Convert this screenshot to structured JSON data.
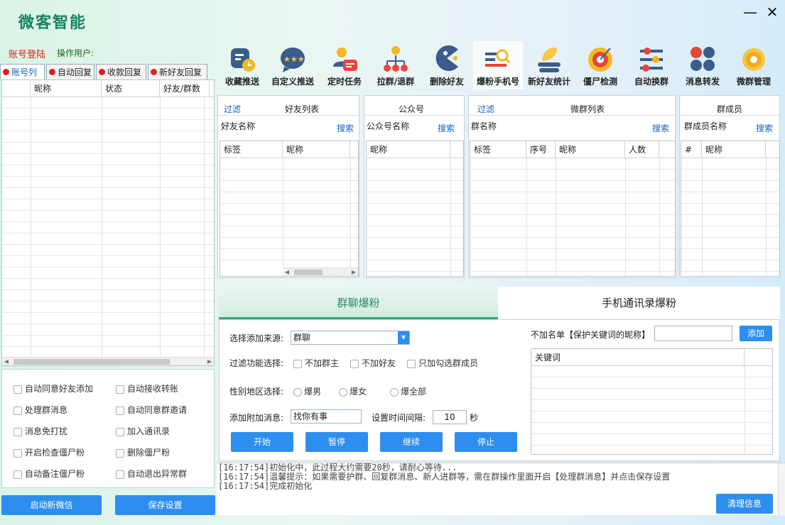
{
  "app": {
    "title": "微客智能",
    "login_label": "账号登陆",
    "operator_label": "操作用户:",
    "minimize": "—",
    "close": "✕"
  },
  "left_tabs": [
    {
      "label": "账号列"
    },
    {
      "label": "自动回复"
    },
    {
      "label": "收款回复"
    },
    {
      "label": "新好友回复"
    }
  ],
  "account_table": {
    "columns": [
      "",
      "昵称",
      "状态",
      "好友/群数"
    ]
  },
  "options": [
    {
      "label": "自动同意好友添加"
    },
    {
      "label": "自动接收转账"
    },
    {
      "label": "处理群消息"
    },
    {
      "label": "自动同意群邀请"
    },
    {
      "label": "消息免打扰"
    },
    {
      "label": "加入通讯录"
    },
    {
      "label": "开启检查僵尸粉"
    },
    {
      "label": "删除僵尸粉"
    },
    {
      "label": "自动备注僵尸粉"
    },
    {
      "label": "自动退出异常群"
    }
  ],
  "left_buttons": {
    "start_wechat": "启动新微信",
    "save_settings": "保存设置"
  },
  "toolbar": [
    {
      "label": "收藏推送",
      "icon": "favorites-push-icon"
    },
    {
      "label": "自定义推送",
      "icon": "custom-push-icon"
    },
    {
      "label": "定时任务",
      "icon": "scheduled-task-icon"
    },
    {
      "label": "拉群/退群",
      "icon": "group-pull-icon"
    },
    {
      "label": "删除好友",
      "icon": "delete-friend-icon"
    },
    {
      "label": "爆粉手机号",
      "icon": "phone-fans-icon"
    },
    {
      "label": "新好友统计",
      "icon": "new-friend-stats-icon"
    },
    {
      "label": "僵尸检测",
      "icon": "zombie-detect-icon"
    },
    {
      "label": "自动换群",
      "icon": "auto-switch-group-icon"
    },
    {
      "label": "消息转发",
      "icon": "message-forward-icon"
    },
    {
      "label": "微群管理",
      "icon": "group-manage-icon"
    }
  ],
  "panels": {
    "friends": {
      "filter": "过滤",
      "title": "好友列表",
      "name_label": "好友名称",
      "search": "搜索",
      "columns": [
        "标签",
        "昵称"
      ]
    },
    "official": {
      "title": "公众号",
      "name_label": "公众号名称",
      "search": "搜索",
      "columns": [
        "昵称"
      ]
    },
    "groups": {
      "filter": "过滤",
      "title": "微群列表",
      "name_label": "群名称",
      "search": "搜索",
      "columns": [
        "标签",
        "序号",
        "昵称",
        "人数"
      ]
    },
    "members": {
      "title": "群成员",
      "name_label": "群成员名称",
      "search": "搜索",
      "columns": [
        "#",
        "昵称"
      ]
    }
  },
  "bottom_tabs": [
    {
      "label": "群聊爆粉"
    },
    {
      "label": "手机通讯录爆粉"
    }
  ],
  "form": {
    "source_label": "选择添加来源:",
    "source_value": "群聊",
    "filter_label": "过滤功能选择:",
    "filters": [
      "不加群主",
      "不加好友",
      "只加勾选群成员"
    ],
    "gender_label": "性别地区选择:",
    "genders": [
      "爆男",
      "爆女",
      "爆全部"
    ],
    "message_label": "添加附加消息:",
    "message_value": "找你有事",
    "interval_label": "设置时间间隔:",
    "interval_value": "10",
    "interval_unit": "秒",
    "buttons": [
      "开始",
      "暂停",
      "继续",
      "停止"
    ],
    "blacklist_label": "不加名单【保护关键词的昵称】",
    "blacklist_add": "添加",
    "keyword_column": "关键词"
  },
  "log": [
    "[16:17:54]初始化中，此过程大约需要20秒，请耐心等待...",
    "[16:17:54]温馨提示：如果需要护群、回复群消息、新人进群等，需在群操作里面开启【处理群消息】并点击保存设置",
    "[16:17:54]完成初始化"
  ],
  "clear_button": "清理信息",
  "colors": {
    "accent": "#2d8ef0",
    "brand_green": "#14845a",
    "alert_red": "#e02020"
  }
}
